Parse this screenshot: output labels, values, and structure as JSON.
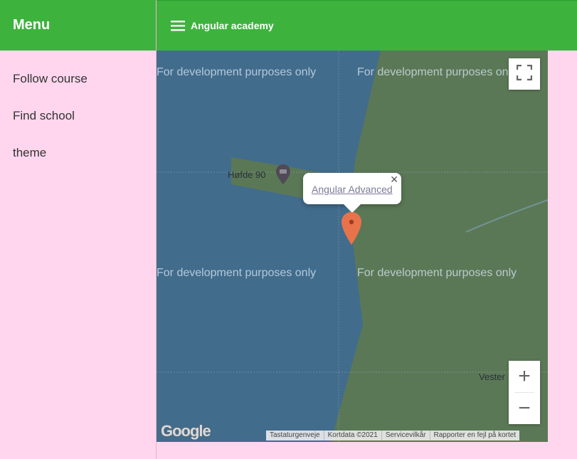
{
  "sidebar": {
    "title": "Menu",
    "items": [
      {
        "label": "Follow course"
      },
      {
        "label": "Find school"
      },
      {
        "label": "theme"
      }
    ]
  },
  "topbar": {
    "title": "Angular academy",
    "menu_icon": "hamburger-icon"
  },
  "map": {
    "watermark": "For development purposes only",
    "poi_label": "Høfde 90",
    "poi_label_partial": "Vester",
    "infowindow": {
      "link": "Angular Advanced",
      "close": "✕"
    },
    "controls": {
      "fullscreen_icon": "fullscreen-icon",
      "zoom_in": "+",
      "zoom_out": "−"
    },
    "google_logo": "Google",
    "attribution": [
      "Tastaturgenveje",
      "Kortdata ©2021",
      "Servicevilkår",
      "Rapporter en fejl på kortet"
    ]
  },
  "colors": {
    "brand_green": "#3db33e",
    "page_pink": "#ffd6ee",
    "marker": "#e8734a"
  }
}
